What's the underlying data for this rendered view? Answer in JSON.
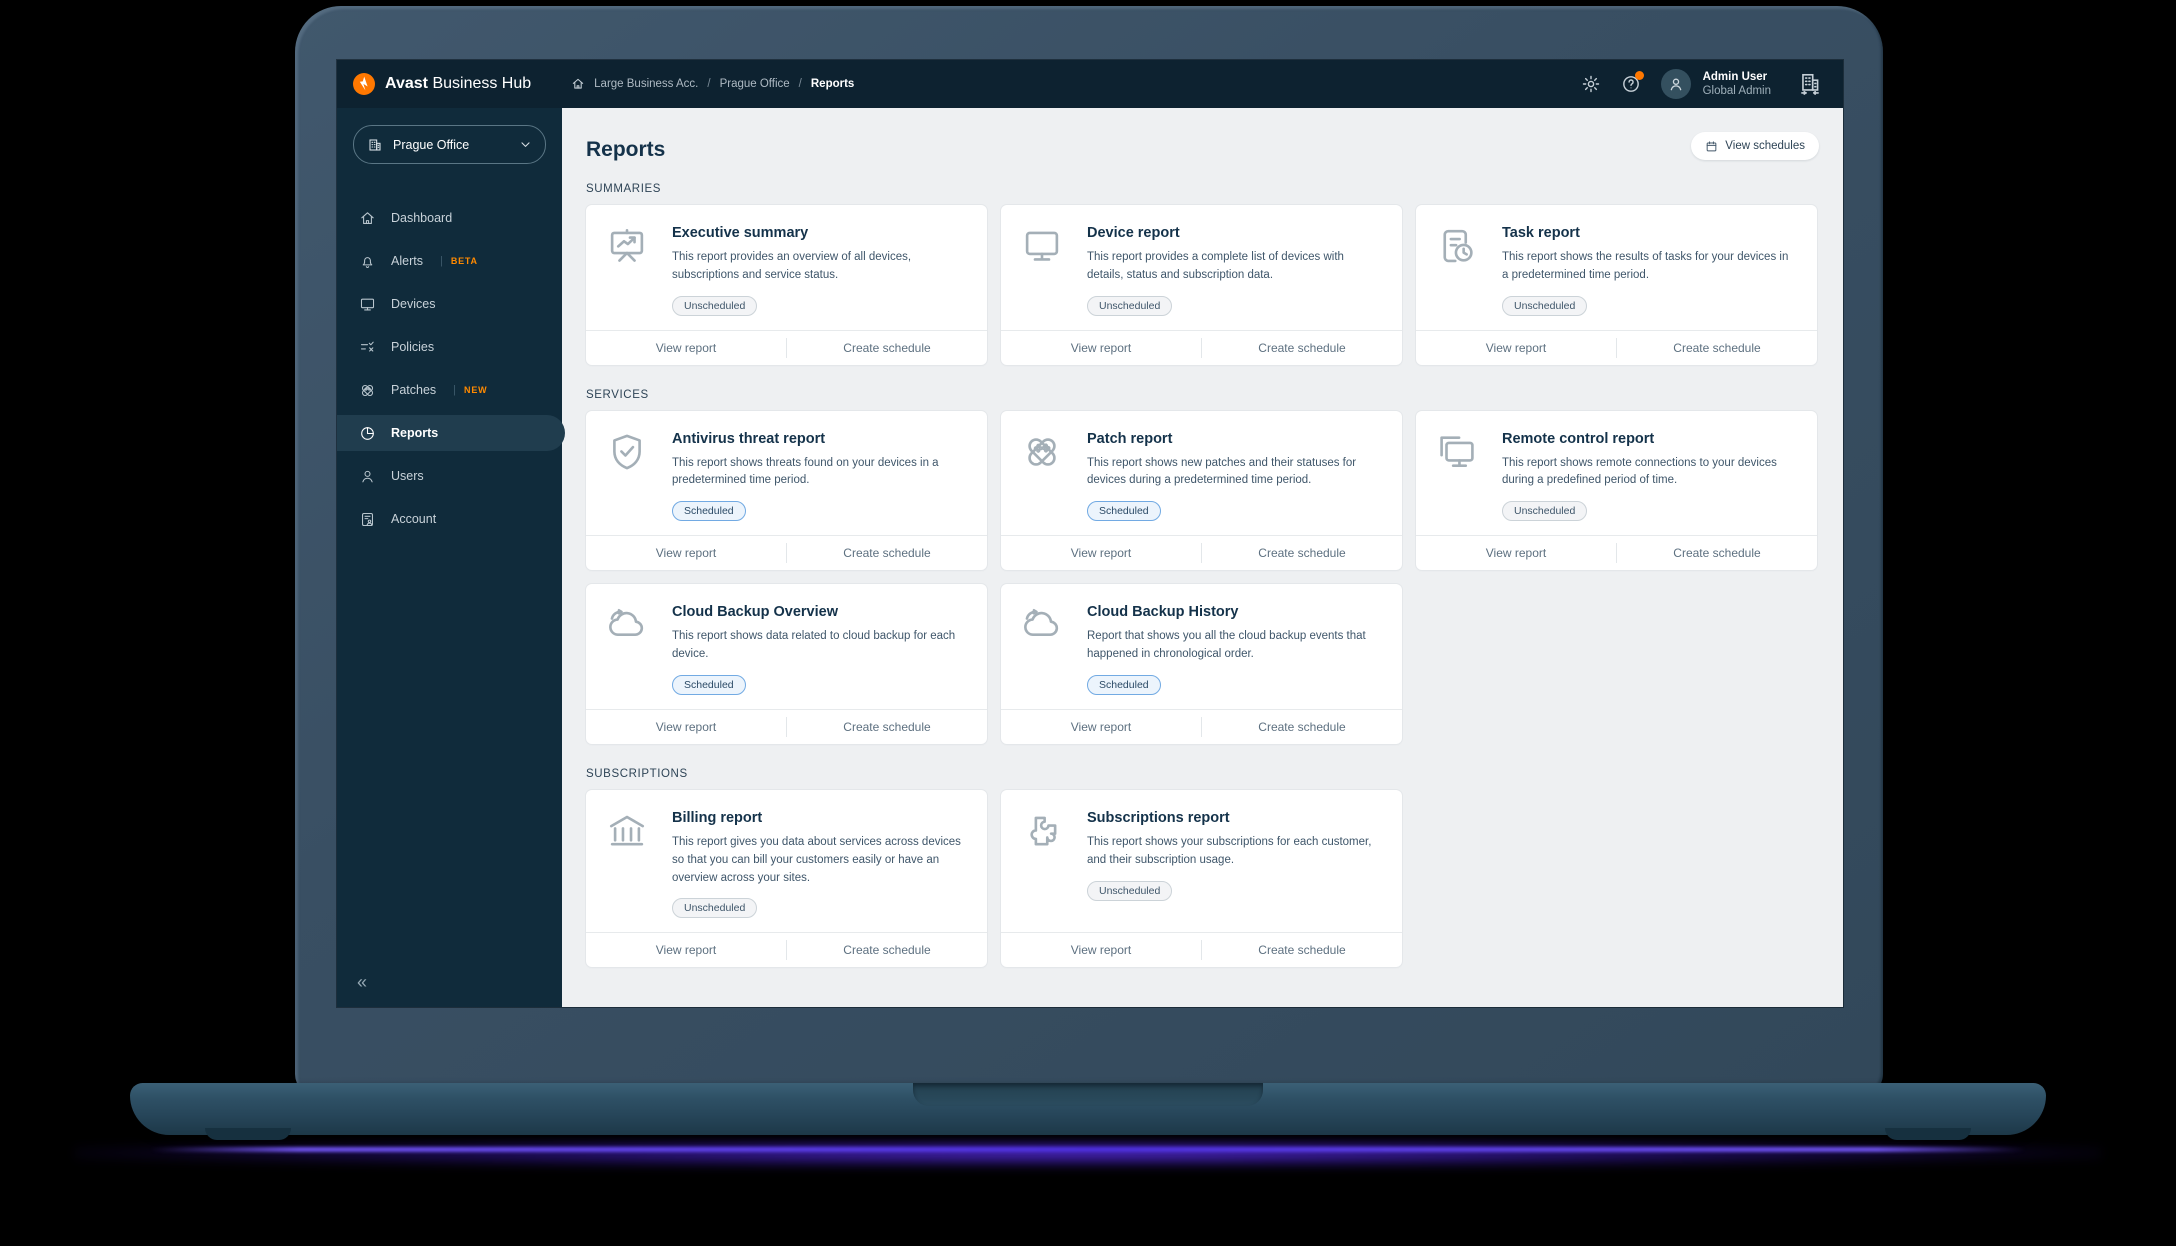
{
  "colors": {
    "accent_orange": "#FF7800",
    "scheduled_blue": "#72AAE3",
    "topbar_bg": "#0D2230",
    "sidebar_bg": "#102B3B",
    "content_bg": "#EEF0F2"
  },
  "topbar": {
    "brand_bold": "Avast",
    "brand_regular": "Business Hub",
    "breadcrumb": [
      "Large Business Acc.",
      "Prague Office",
      "Reports"
    ],
    "user": {
      "name": "Admin User",
      "role": "Global Admin"
    },
    "icons": [
      "settings-icon",
      "help-icon",
      "avatar",
      "company-switcher-icon"
    ]
  },
  "sidebar": {
    "site_selector": {
      "label": "Prague Office",
      "icon": "building-icon"
    },
    "items": [
      {
        "label": "Dashboard",
        "icon": "home-icon",
        "active": false
      },
      {
        "label": "Alerts",
        "icon": "bell-icon",
        "badge": "BETA",
        "active": false
      },
      {
        "label": "Devices",
        "icon": "monitor-icon",
        "active": false
      },
      {
        "label": "Policies",
        "icon": "policies-icon",
        "active": false
      },
      {
        "label": "Patches",
        "icon": "patches-icon",
        "badge": "NEW",
        "active": false
      },
      {
        "label": "Reports",
        "icon": "reports-icon",
        "active": true
      },
      {
        "label": "Users",
        "icon": "user-icon",
        "active": false
      },
      {
        "label": "Account",
        "icon": "account-icon",
        "active": false
      }
    ],
    "collapse_glyph": "«"
  },
  "main": {
    "title": "Reports",
    "view_schedules_label": "View schedules",
    "card_footer": {
      "view": "View report",
      "create": "Create schedule"
    },
    "sections": [
      {
        "label": "SUMMARIES",
        "cards": [
          {
            "icon": "presentation-chart-icon",
            "title": "Executive summary",
            "desc": "This report provides an overview of all devices, subscriptions and service status.",
            "status": "Unscheduled"
          },
          {
            "icon": "monitor-icon",
            "title": "Device report",
            "desc": "This report provides a complete list of devices with details, status and subscription data.",
            "status": "Unscheduled"
          },
          {
            "icon": "task-clock-icon",
            "title": "Task report",
            "desc": "This report shows the results of tasks for your devices in a predetermined time period.",
            "status": "Unscheduled"
          }
        ]
      },
      {
        "label": "SERVICES",
        "cards": [
          {
            "icon": "shield-check-icon",
            "title": "Antivirus threat report",
            "desc": "This report shows threats found on your devices in a predetermined time period.",
            "status": "Scheduled"
          },
          {
            "icon": "patches-icon",
            "title": "Patch report",
            "desc": "This report shows new patches and their statuses for devices during a predetermined time period.",
            "status": "Scheduled"
          },
          {
            "icon": "remote-monitor-icon",
            "title": "Remote control report",
            "desc": "This report shows remote connections to your devices during a predefined period of time.",
            "status": "Unscheduled"
          },
          {
            "icon": "cloud-backup-icon",
            "title": "Cloud Backup Overview",
            "desc": "This report shows data related to cloud backup for each device.",
            "status": "Scheduled"
          },
          {
            "icon": "cloud-backup-icon",
            "title": "Cloud Backup History",
            "desc": "Report that shows you all the cloud backup events that happened in chronological order.",
            "status": "Scheduled"
          }
        ]
      },
      {
        "label": "SUBSCRIPTIONS",
        "cards": [
          {
            "icon": "bank-icon",
            "title": "Billing report",
            "desc": "This report gives you data about services across devices so that you can bill your customers easily or have an overview across your sites.",
            "status": "Unscheduled"
          },
          {
            "icon": "puzzle-shield-icon",
            "title": "Subscriptions report",
            "desc": "This report shows your subscriptions for each customer, and their subscription usage.",
            "status": "Unscheduled"
          }
        ]
      }
    ]
  }
}
